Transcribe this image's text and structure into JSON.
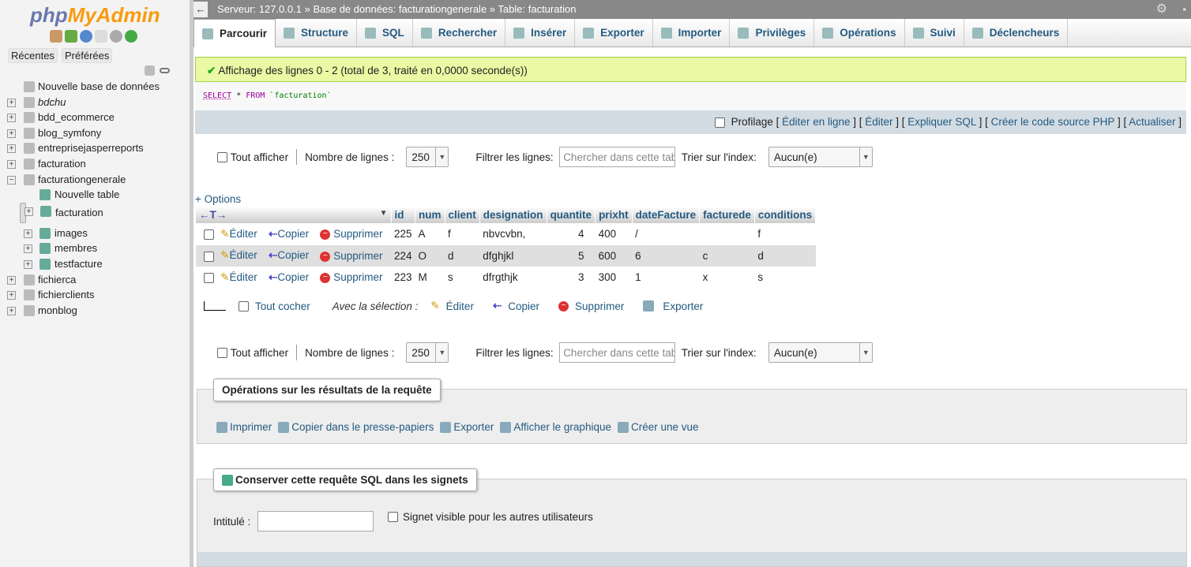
{
  "sidebar": {
    "logo": "phpMyAdmin",
    "logo_parts": [
      "php",
      "MyAdmin"
    ],
    "tabs": [
      "Récentes",
      "Préférées"
    ],
    "icons": [
      "home-icon",
      "logout-icon",
      "help-icon",
      "docs-icon",
      "settings-icon",
      "reload-icon"
    ],
    "new_db": "Nouvelle base de données",
    "databases": [
      {
        "name": "bdchu",
        "italic": true
      },
      {
        "name": "bdd_ecommerce"
      },
      {
        "name": "blog_symfony"
      },
      {
        "name": "entreprisejasperreports"
      },
      {
        "name": "facturation"
      },
      {
        "name": "facturationgenerale",
        "expanded": true
      }
    ],
    "sub_items": {
      "new_table": "Nouvelle table",
      "tables": [
        "facturation",
        "images",
        "membres",
        "testfacture"
      ],
      "selected": "facturation"
    },
    "databases_after": [
      "fichierca",
      "fichierclients",
      "monblog"
    ]
  },
  "topbar": {
    "server": "Serveur: 127.0.0.1",
    "sep": "»",
    "database": "Base de données: facturationgenerale",
    "table": "Table: facturation"
  },
  "tabs": [
    {
      "label": "Parcourir",
      "icon": "browse-icon",
      "active": true
    },
    {
      "label": "Structure",
      "icon": "structure-icon"
    },
    {
      "label": "SQL",
      "icon": "sql-icon"
    },
    {
      "label": "Rechercher",
      "icon": "search-icon"
    },
    {
      "label": "Insérer",
      "icon": "insert-icon"
    },
    {
      "label": "Exporter",
      "icon": "export-icon"
    },
    {
      "label": "Importer",
      "icon": "import-icon"
    },
    {
      "label": "Privilèges",
      "icon": "privileges-icon"
    },
    {
      "label": "Opérations",
      "icon": "operations-icon"
    },
    {
      "label": "Suivi",
      "icon": "tracking-icon"
    },
    {
      "label": "Déclencheurs",
      "icon": "triggers-icon"
    }
  ],
  "success": "Affichage des lignes 0 - 2 (total de 3, traité en 0,0000 seconde(s))",
  "sql": {
    "select": "SELECT",
    "star": " * ",
    "from": "FROM",
    "table": " `facturation`"
  },
  "profiling": {
    "label": "Profilage",
    "links": [
      "Éditer en ligne",
      "Éditer",
      "Expliquer SQL",
      "Créer le code source PHP",
      "Actualiser"
    ]
  },
  "nav": {
    "show_all": "Tout afficher",
    "rows_label": "Nombre de lignes :",
    "rows_value": "250",
    "filter_label": "Filtrer les lignes:",
    "filter_placeholder": "Chercher dans cette table",
    "sort_label": "Trier sur l'index:",
    "sort_value": "Aucun(e)"
  },
  "options": "+ Options",
  "table": {
    "columns": [
      "id",
      "num",
      "client",
      "designation",
      "quantite",
      "prixht",
      "dateFacture",
      "facturede",
      "conditions"
    ],
    "actions": {
      "edit": "Éditer",
      "copy": "Copier",
      "delete": "Supprimer"
    },
    "rows": [
      [
        "225",
        "A",
        "f",
        "nbvcvbn,",
        "4",
        "400",
        "/",
        "",
        "f"
      ],
      [
        "224",
        "O",
        "d",
        "dfghjkl",
        "5",
        "600",
        "6",
        "c",
        "d"
      ],
      [
        "223",
        "M",
        "s",
        "dfrgthjk",
        "3",
        "300",
        "1",
        "x",
        "s"
      ]
    ]
  },
  "bulk": {
    "check_all": "Tout cocher",
    "with_selection": "Avec la sélection :",
    "edit": "Éditer",
    "copy": "Copier",
    "delete": "Supprimer",
    "export": "Exporter"
  },
  "query_ops": {
    "title": "Opérations sur les résultats de la requête",
    "links": [
      "Imprimer",
      "Copier dans le presse-papiers",
      "Exporter",
      "Afficher le graphique",
      "Créer une vue"
    ]
  },
  "bookmark": {
    "title": "Conserver cette requête SQL dans les signets",
    "label": "Intitulé :",
    "visible": "Signet visible pour les autres utilisateurs"
  }
}
